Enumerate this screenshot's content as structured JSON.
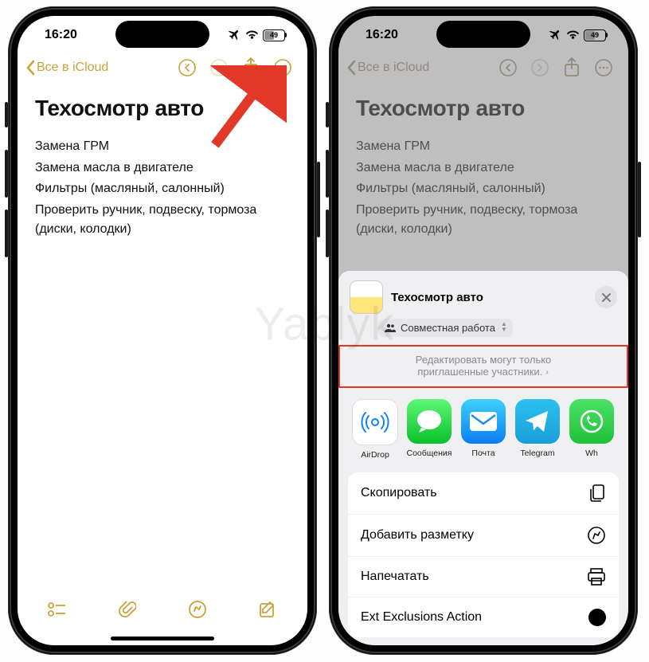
{
  "status": {
    "time": "16:20",
    "battery": "49"
  },
  "nav": {
    "back": "Все в iCloud"
  },
  "note": {
    "title": "Техосмотр авто",
    "lines": [
      "Замена ГРМ",
      "Замена масла в двигателе",
      "Фильтры (масляный, салонный)",
      "Проверить ручник, подвеску, тормоза (диски, колодки)"
    ]
  },
  "sheet": {
    "title": "Техосмотр авто",
    "collab": "Совместная работа",
    "perm1": "Редактировать могут только",
    "perm2": "приглашенные участники.",
    "apps": [
      {
        "name": "AirDrop"
      },
      {
        "name": "Сообщения"
      },
      {
        "name": "Почта"
      },
      {
        "name": "Telegram"
      },
      {
        "name": "Wh"
      }
    ],
    "actions": [
      "Скопировать",
      "Добавить разметку",
      "Напечатать",
      "Ext Exclusions Action"
    ]
  },
  "watermark": "Yablyk"
}
